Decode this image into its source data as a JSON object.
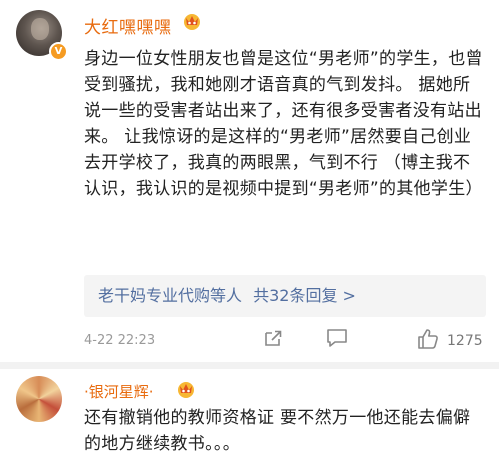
{
  "comments": [
    {
      "username": "大红嘿嘿嘿",
      "verified_badge": "V",
      "text": "身边一位女性朋友也曾是这位“男老师”的学生，也曾受到骚扰，我和她刚才语音真的气到发抖。 据她所说一些的受害者站出来了，还有很多受害者没有站出来。 让我惊讶的是这样的“男老师”居然要自己创业去开学校了，我真的两眼黑，气到不行 （博主我不认识，我认识的是视频中提到“男老师”的其他学生）",
      "replies_preview": "老干妈专业代购等人",
      "replies_count": "共32条回复 >",
      "timestamp": "4-22 22:23",
      "like_count": "1275",
      "icons": [
        "share-icon",
        "comment-icon",
        "like-icon"
      ]
    },
    {
      "username": "·银河星辉·",
      "text": "还有撤销他的教师资格证 要不然万一他还能去偏僻的地方继续教书。。。"
    }
  ],
  "colors": {
    "username": "#e86b0f",
    "link": "#536fa0",
    "text": "#222222",
    "muted": "#9a9a9a",
    "badge": "#f59b22"
  }
}
